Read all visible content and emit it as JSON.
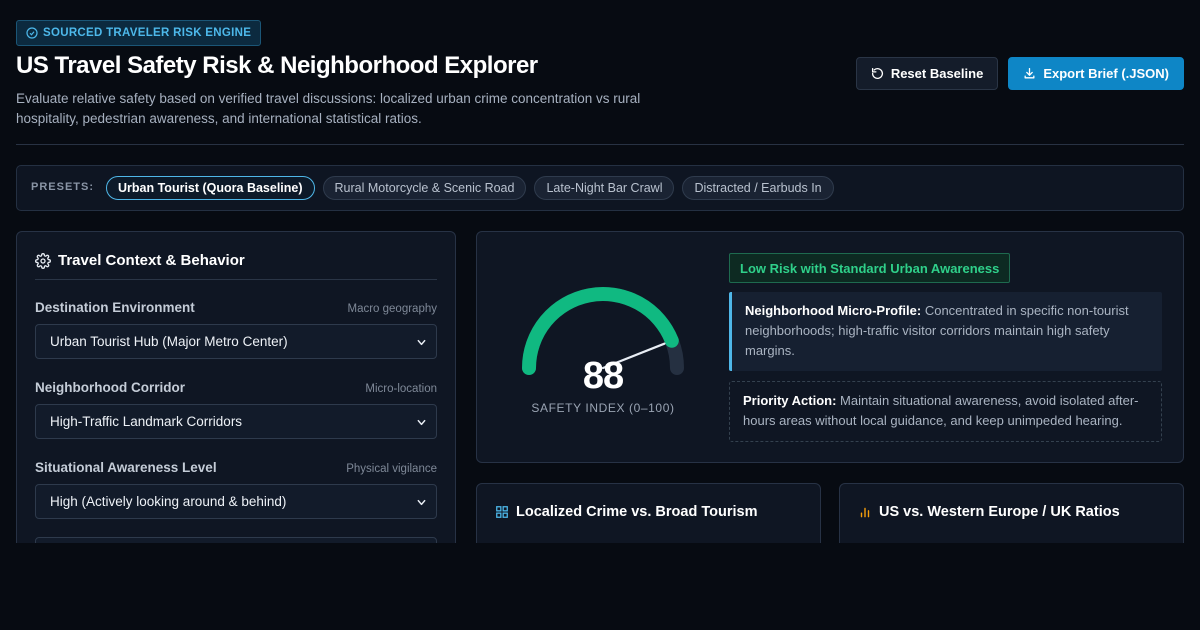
{
  "header": {
    "badge": "SOURCED TRAVELER RISK ENGINE",
    "title": "US Travel Safety Risk & Neighborhood Explorer",
    "subtitle": "Evaluate relative safety based on verified travel discussions: localized urban crime concentration vs rural hospitality, pedestrian awareness, and international statistical ratios.",
    "reset_label": "Reset Baseline",
    "export_label": "Export Brief (.JSON)"
  },
  "presets": {
    "label": "PRESETS:",
    "items": [
      {
        "label": "Urban Tourist (Quora Baseline)",
        "active": true
      },
      {
        "label": "Rural Motorcycle & Scenic Road",
        "active": false
      },
      {
        "label": "Late-Night Bar Crawl",
        "active": false
      },
      {
        "label": "Distracted / Earbuds In",
        "active": false
      }
    ]
  },
  "context_panel": {
    "title": "Travel Context & Behavior",
    "fields": [
      {
        "label": "Destination Environment",
        "hint": "Macro geography",
        "value": "Urban Tourist Hub (Major Metro Center)"
      },
      {
        "label": "Neighborhood Corridor",
        "hint": "Micro-location",
        "value": "High-Traffic Landmark Corridors"
      },
      {
        "label": "Situational Awareness Level",
        "hint": "Physical vigilance",
        "value": "High (Actively looking around & behind)"
      }
    ]
  },
  "score": {
    "value": 88,
    "max": 100,
    "caption": "SAFETY INDEX (0–100)",
    "risk_label": "Low Risk with Standard Urban Awareness",
    "profile_title": "Neighborhood Micro-Profile:",
    "profile_text": " Concentrated in specific non-tourist neighborhoods; high-traffic visitor corridors maintain high safety margins.",
    "action_title": "Priority Action:",
    "action_text": " Maintain situational awareness, avoid isolated after-hours areas without local guidance, and keep unimpeded hearing."
  },
  "cards": {
    "crime_title": "Localized Crime vs. Broad Tourism",
    "ratios_title": "US vs. Western Europe / UK Ratios"
  },
  "colors": {
    "accent": "#0e86c6",
    "gauge_fill": "#10b981",
    "gauge_track": "#253041",
    "risk_green": "#2fd08a",
    "chart_amber": "#f59e0b"
  },
  "icons": {
    "badge": "check-circle-icon",
    "reset": "rotate-ccw-icon",
    "export": "download-icon",
    "panel": "gear-icon",
    "crime": "grid-icon",
    "ratios": "bar-chart-icon",
    "select": "chevron-down-icon"
  }
}
